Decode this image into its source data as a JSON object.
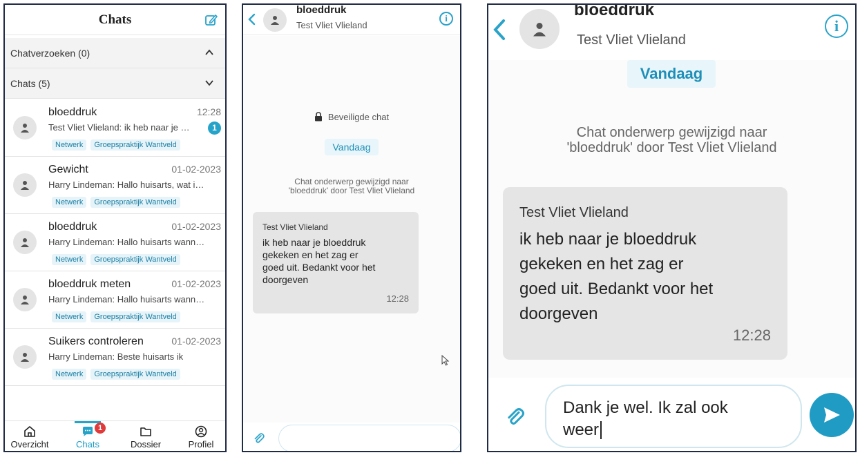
{
  "colors": {
    "accent": "#26a3c9",
    "badge_red": "#e03a3a",
    "tag_bg": "#e6f4f9",
    "bubble": "#e5e5e5"
  },
  "list": {
    "title": "Chats",
    "compose_icon": "edit-icon",
    "requests_label": "Chatverzoeken (0)",
    "chats_label": "Chats (5)",
    "items": [
      {
        "name": "bloeddruk",
        "time": "12:28",
        "preview": "Test Vliet Vlieland: ik heb naar je bloeddruk gekeken",
        "unread": "1",
        "tags": [
          "Netwerk",
          "Groepspraktijk Wantveld"
        ]
      },
      {
        "name": "Gewicht",
        "time": "01-02-2023",
        "preview": "Harry Lindeman: Hallo huisarts, wat is mijn gewicht",
        "unread": "",
        "tags": [
          "Netwerk",
          "Groepspraktijk Wantveld"
        ]
      },
      {
        "name": "bloeddruk",
        "time": "01-02-2023",
        "preview": "Harry Lindeman: Hallo huisarts wanneer kan ik",
        "unread": "",
        "tags": [
          "Netwerk",
          "Groepspraktijk Wantveld"
        ]
      },
      {
        "name": "bloeddruk meten",
        "time": "01-02-2023",
        "preview": "Harry Lindeman: Hallo huisarts wanneer kan ik",
        "unread": "",
        "tags": [
          "Netwerk",
          "Groepspraktijk Wantveld"
        ]
      },
      {
        "name": "Suikers controleren",
        "time": "01-02-2023",
        "preview": "Harry Lindeman: Beste huisarts ik",
        "unread": "",
        "tags": [
          "Netwerk",
          "Groepspraktijk Wantveld"
        ]
      }
    ],
    "tabs": {
      "overview": "Overzicht",
      "chats": "Chats",
      "chats_badge": "1",
      "dossier": "Dossier",
      "profile": "Profiel"
    }
  },
  "conversation": {
    "title": "bloeddruk",
    "subtitle": "Test Vliet Vlieland",
    "secure_label": "Beveiligde chat",
    "date_label": "Vandaag",
    "system_message_line1": "Chat onderwerp gewijzigd naar",
    "system_message_line2": "'bloeddruk' door Test Vliet Vlieland",
    "message": {
      "sender": "Test Vliet Vlieland",
      "line1": "ik heb naar je bloeddruk",
      "line2": "gekeken en het zag er",
      "line3": "goed uit. Bedankt voor het",
      "line4": "doorgeven",
      "time": "12:28"
    },
    "zoom_message_lines": [
      "ik heb naar je bloeddruk",
      "gekeken en het zag er",
      "goed uit. Bedankt voor het",
      "doorgeven"
    ],
    "draft_line1": "Dank je wel.  Ik zal ook",
    "draft_line2": "weer"
  }
}
